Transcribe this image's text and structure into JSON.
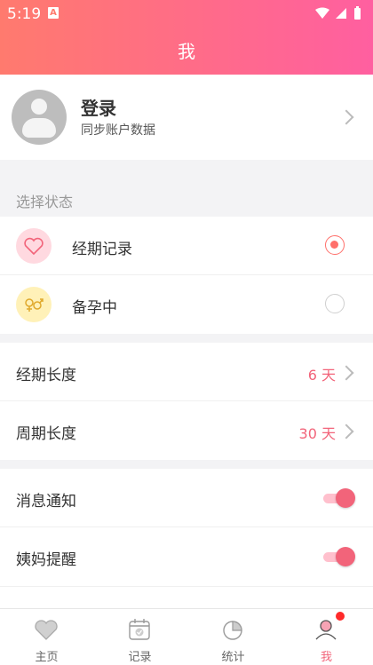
{
  "status_bar": {
    "time": "5:19",
    "notification_icon": "A"
  },
  "header": {
    "title": "我"
  },
  "profile": {
    "name": "登录",
    "subtitle": "同步账户数据"
  },
  "select_state": {
    "label": "选择状态",
    "options": [
      {
        "label": "经期记录",
        "icon": "heart-icon",
        "selected": true
      },
      {
        "label": "备孕中",
        "icon": "gender-icon",
        "selected": false
      }
    ]
  },
  "settings": [
    {
      "label": "经期长度",
      "value": "6 天"
    },
    {
      "label": "周期长度",
      "value": "30 天"
    }
  ],
  "toggles": [
    {
      "label": "消息通知",
      "on": true
    },
    {
      "label": "姨妈提醒",
      "on": true
    }
  ],
  "tabs": [
    {
      "label": "主页",
      "icon": "heart-tab-icon"
    },
    {
      "label": "记录",
      "icon": "calendar-icon"
    },
    {
      "label": "统计",
      "icon": "pie-chart-icon"
    },
    {
      "label": "我",
      "icon": "user-icon",
      "active": true
    }
  ],
  "colors": {
    "accent": "#f2647a",
    "header_start": "#ff7a6e",
    "header_end": "#ff5fa0"
  }
}
